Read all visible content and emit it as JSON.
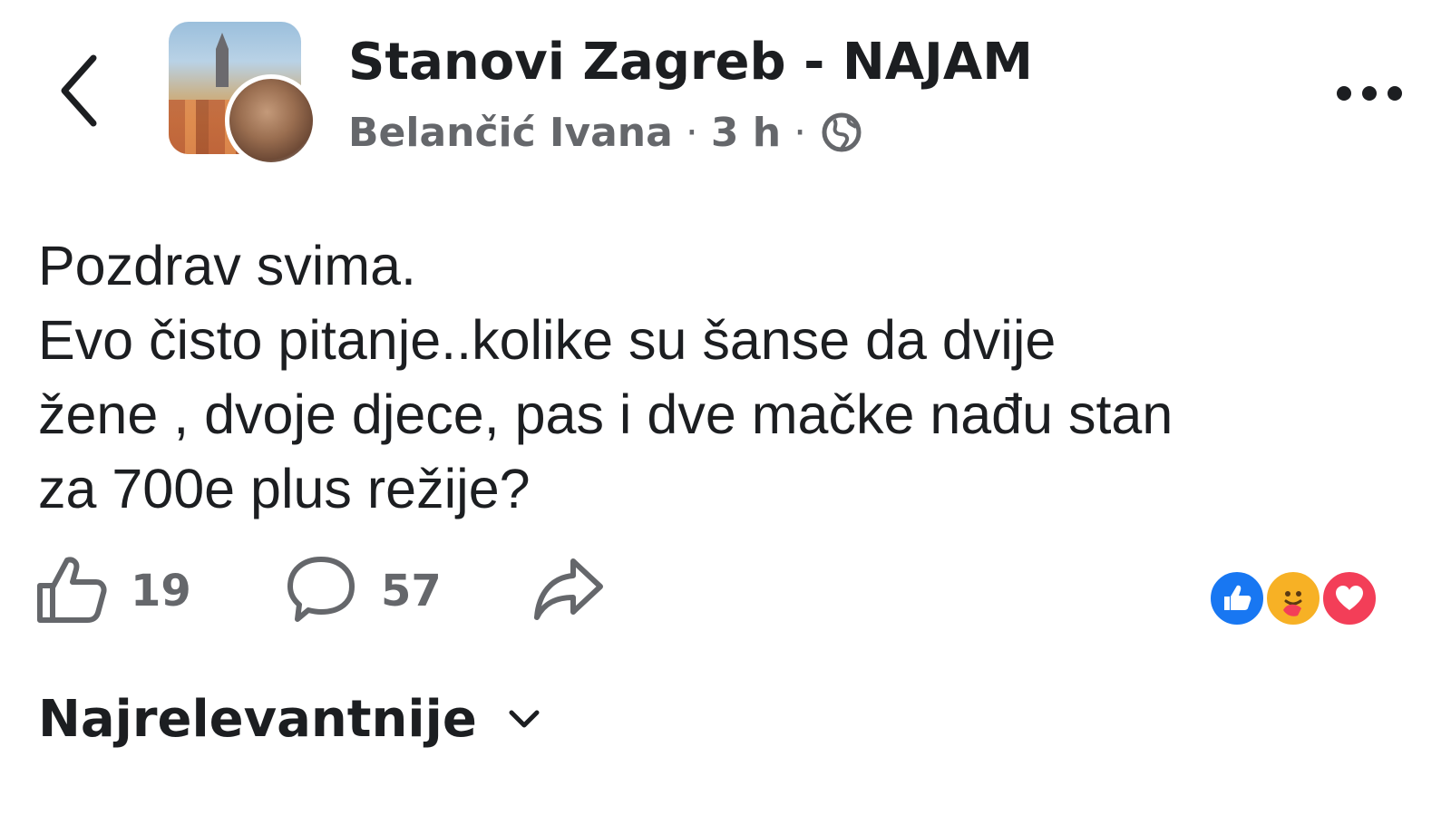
{
  "header": {
    "back_icon": "chevron-left-icon",
    "group_name": "Stanovi Zagreb - NAJAM",
    "author": "Belančić Ivana",
    "separator": "·",
    "time": "3 h",
    "privacy_icon": "globe-icon",
    "more_icon": "more-horizontal-icon"
  },
  "post": {
    "lines": [
      "Pozdrav svima.",
      "Evo čisto pitanje..kolike su šanse da dvije",
      "žene , dvoje djece, pas i dve mačke nađu stan",
      "za 700e plus režije?"
    ]
  },
  "actions": {
    "like_icon": "thumbs-up-icon",
    "like_count": "19",
    "comment_icon": "comment-icon",
    "comment_count": "57",
    "share_icon": "share-icon"
  },
  "reactions": [
    "like",
    "care",
    "love"
  ],
  "sort": {
    "label": "Najrelevantnije",
    "icon": "chevron-down-icon"
  },
  "colors": {
    "text_primary": "#1c1e21",
    "text_secondary": "#65676b",
    "like_blue": "#1877f2",
    "care_yellow": "#f7b125",
    "love_red": "#f33e58"
  }
}
